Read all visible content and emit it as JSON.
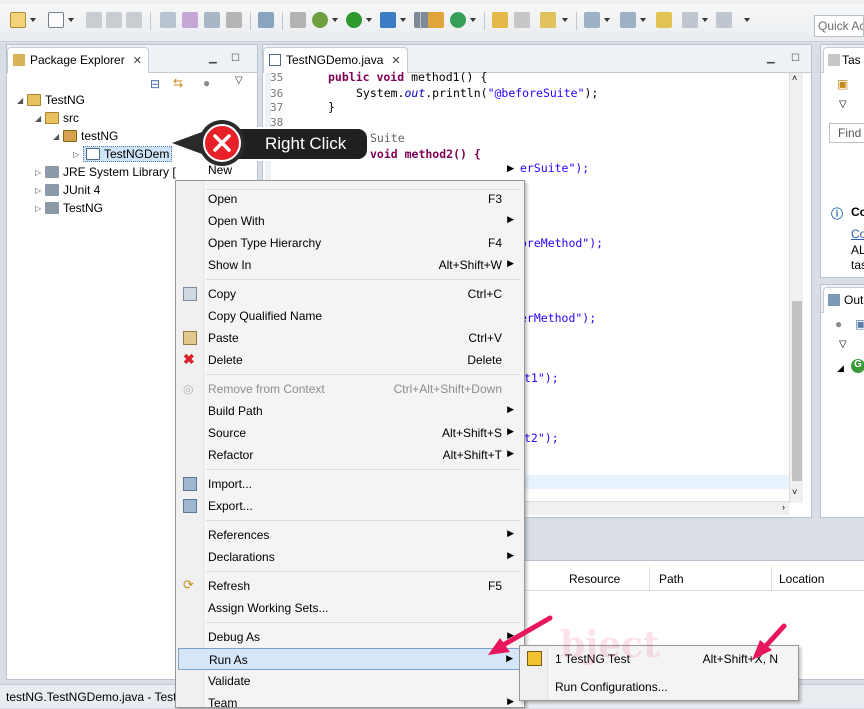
{
  "toolbar": {
    "quick_access": "Quick Access"
  },
  "package_explorer": {
    "tab_label": "Package Explorer",
    "tree": [
      {
        "label": "TestNG",
        "level": 0,
        "icon": "project-icon"
      },
      {
        "label": "src",
        "level": 1,
        "icon": "source-folder-icon"
      },
      {
        "label": "testNG",
        "level": 2,
        "icon": "package-icon"
      },
      {
        "label": "TestNGDem",
        "level": 3,
        "icon": "java-file-icon"
      },
      {
        "label": "JRE System Library [",
        "level": 1,
        "icon": "library-icon"
      },
      {
        "label": "JUnit 4",
        "level": 1,
        "icon": "library-icon"
      },
      {
        "label": "TestNG",
        "level": 1,
        "icon": "library-icon"
      }
    ]
  },
  "editor": {
    "tab_label": "TestNGDemo.java",
    "line_numbers": [
      "35",
      "36",
      "37",
      "38"
    ],
    "code_lines": [
      {
        "kw": "public void",
        "rest": " method1() {"
      },
      {
        "pre": "System.",
        "field": "out",
        "post": ".println(",
        "str": "\"@beforeSuite\"",
        "end": ");"
      },
      {
        "rest": "}"
      }
    ],
    "partial": [
      "Suite",
      "void method2() {",
      "erSuite\");",
      "oreMethod\");",
      "erMethod\");",
      "t1\");",
      "t2\");"
    ]
  },
  "right_panels": {
    "task_tab": "Tas",
    "find_label": "Find",
    "info_title": "Co",
    "info_link": "Co",
    "info_text_1": "AL",
    "info_text_2": "tas",
    "outline_tab": "Out"
  },
  "bottom_table": {
    "columns": [
      "Resource",
      "Path",
      "Location"
    ]
  },
  "status_bar": {
    "text": "testNG.TestNGDemo.java - Test"
  },
  "callout": {
    "label": "Right Click"
  },
  "context_menu": {
    "items": [
      {
        "label": "New",
        "shortcut": "",
        "submenu": true,
        "top_item": true
      },
      {
        "label": "Open",
        "shortcut": "F3"
      },
      {
        "label": "Open With",
        "shortcut": "",
        "submenu": true
      },
      {
        "label": "Open Type Hierarchy",
        "shortcut": "F4"
      },
      {
        "label": "Show In",
        "shortcut": "Alt+Shift+W",
        "submenu": true
      },
      {
        "label": "Copy",
        "shortcut": "Ctrl+C",
        "icon": "copy-icon"
      },
      {
        "label": "Copy Qualified Name",
        "shortcut": ""
      },
      {
        "label": "Paste",
        "shortcut": "Ctrl+V",
        "icon": "paste-icon"
      },
      {
        "label": "Delete",
        "shortcut": "Delete",
        "icon": "delete-icon"
      },
      {
        "label": "Remove from Context",
        "shortcut": "Ctrl+Alt+Shift+Down",
        "disabled": true
      },
      {
        "label": "Build Path",
        "shortcut": "",
        "submenu": true
      },
      {
        "label": "Source",
        "shortcut": "Alt+Shift+S",
        "submenu": true
      },
      {
        "label": "Refactor",
        "shortcut": "Alt+Shift+T",
        "submenu": true
      },
      {
        "label": "Import...",
        "shortcut": "",
        "icon": "import-icon"
      },
      {
        "label": "Export...",
        "shortcut": "",
        "icon": "export-icon"
      },
      {
        "label": "References",
        "shortcut": "",
        "submenu": true
      },
      {
        "label": "Declarations",
        "shortcut": "",
        "submenu": true
      },
      {
        "label": "Refresh",
        "shortcut": "F5",
        "icon": "refresh-icon"
      },
      {
        "label": "Assign Working Sets...",
        "shortcut": ""
      },
      {
        "label": "Debug As",
        "shortcut": "",
        "submenu": true
      },
      {
        "label": "Run As",
        "shortcut": "",
        "submenu": true,
        "highlighted": true
      },
      {
        "label": "Validate",
        "shortcut": ""
      },
      {
        "label": "Team",
        "shortcut": "",
        "submenu": true
      }
    ]
  },
  "submenu": {
    "items": [
      {
        "label": "1 TestNG Test",
        "shortcut": "Alt+Shift+X, N"
      },
      {
        "label": "Run Configurations...",
        "shortcut": ""
      }
    ]
  },
  "colors": {
    "accent": "#e8175d",
    "callout_red": "#e8202a",
    "highlight": "#d5e6f8"
  }
}
